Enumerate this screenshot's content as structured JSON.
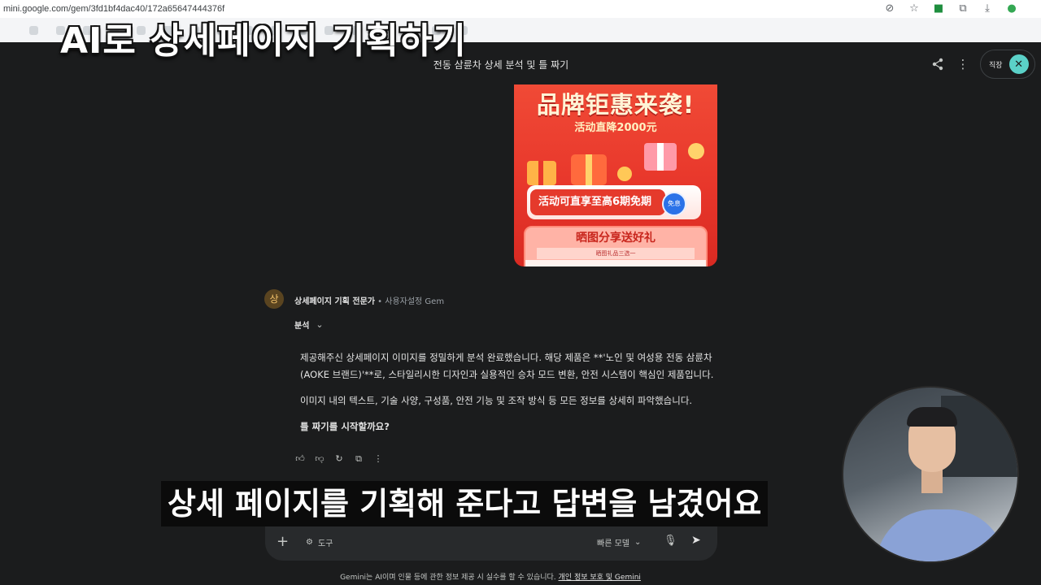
{
  "browser": {
    "url": "mini.google.com/gem/3fd1bf4dac40/172a65647444376f",
    "icons": [
      "eye-off-icon",
      "star-icon",
      "extension-icon",
      "puzzle-icon",
      "download-icon",
      "profile-icon"
    ]
  },
  "overlay_title": "AI로 상세페이지 기획하기",
  "header": {
    "conversation_title": "전동 삼륜차 상세 분석 및 틀 짜기",
    "account_label": "직장"
  },
  "promo_image": {
    "headline": "品牌钜惠来袭!",
    "subline": "活动直降2000元",
    "button_text": "活动可直享至高6期免期",
    "badge": "免息",
    "card_title": "晒图分享送好礼",
    "card_strip": "晒图礼品三选一"
  },
  "response": {
    "gem_avatar": "상",
    "gem_name": "상세페이지 기획 전문가",
    "gem_separator": "•",
    "gem_type": "사용자설정 Gem",
    "thinking_label": "분석",
    "paragraph1": "제공해주신 상세페이지 이미지를 정밀하게 분석 완료했습니다. 해당 제품은 **'노인 및 여성용 전동 삼륜차 (AOKE 브랜드)'**로, 스타일리시한 디자인과 실용적인 승차 모드 변환, 안전 시스템이 핵심인 제품입니다.",
    "paragraph2": "이미지 내의 텍스트, 기술 사양, 구성품, 안전 기능 및 조작 방식 등 모든 정보를 상세히 파악했습니다.",
    "question": "틀 짜기를 시작할까요?"
  },
  "composer": {
    "tools_label": "도구",
    "model_label": "빠른 모델"
  },
  "footer": {
    "text": "Gemini는 AI이며 인물 등에 관한 정보 제공 시 실수를 할 수 있습니다.",
    "link": "개인 정보 보호 및 Gemini"
  },
  "subtitle": "상세 페이지를 기획해 준다고 답변을 남겼어요"
}
